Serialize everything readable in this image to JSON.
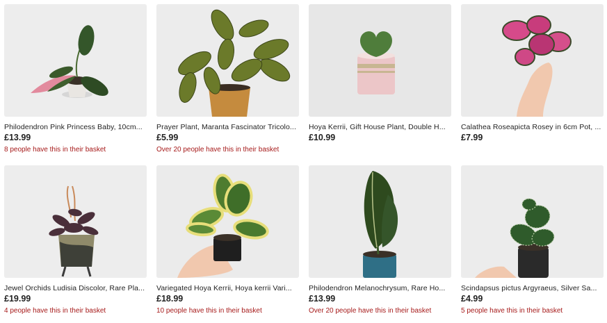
{
  "listings": [
    {
      "title": "Philodendron Pink Princess Baby, 10cm...",
      "price": "£13.99",
      "basket": "8 people have this in their basket",
      "image": "pink-princess-plant"
    },
    {
      "title": "Prayer Plant, Maranta Fascinator Tricolo...",
      "price": "£5.99",
      "basket": "Over 20 people have this in their basket",
      "image": "prayer-plant"
    },
    {
      "title": "Hoya Kerrii, Gift House Plant, Double H...",
      "price": "£10.99",
      "basket": "",
      "image": "hoya-heart-pot"
    },
    {
      "title": "Calathea Roseapicta Rosey in 6cm Pot, ...",
      "price": "£7.99",
      "basket": "",
      "image": "calathea-in-hand"
    },
    {
      "title": "Jewel Orchids Ludisia Discolor, Rare Pla...",
      "price": "£19.99",
      "basket": "4 people have this in their basket",
      "image": "jewel-orchid"
    },
    {
      "title": "Variegated Hoya Kerrii, Hoya kerrii Vari...",
      "price": "£18.99",
      "basket": "10 people have this in their basket",
      "image": "variegated-hoya"
    },
    {
      "title": "Philodendron Melanochrysum, Rare Ho...",
      "price": "£13.99",
      "basket": "Over 20 people have this in their basket",
      "image": "melanochrysum"
    },
    {
      "title": "Scindapsus pictus Argyraeus, Silver Sa...",
      "price": "£4.99",
      "basket": "5 people have this in their basket",
      "image": "scindapsus"
    }
  ]
}
